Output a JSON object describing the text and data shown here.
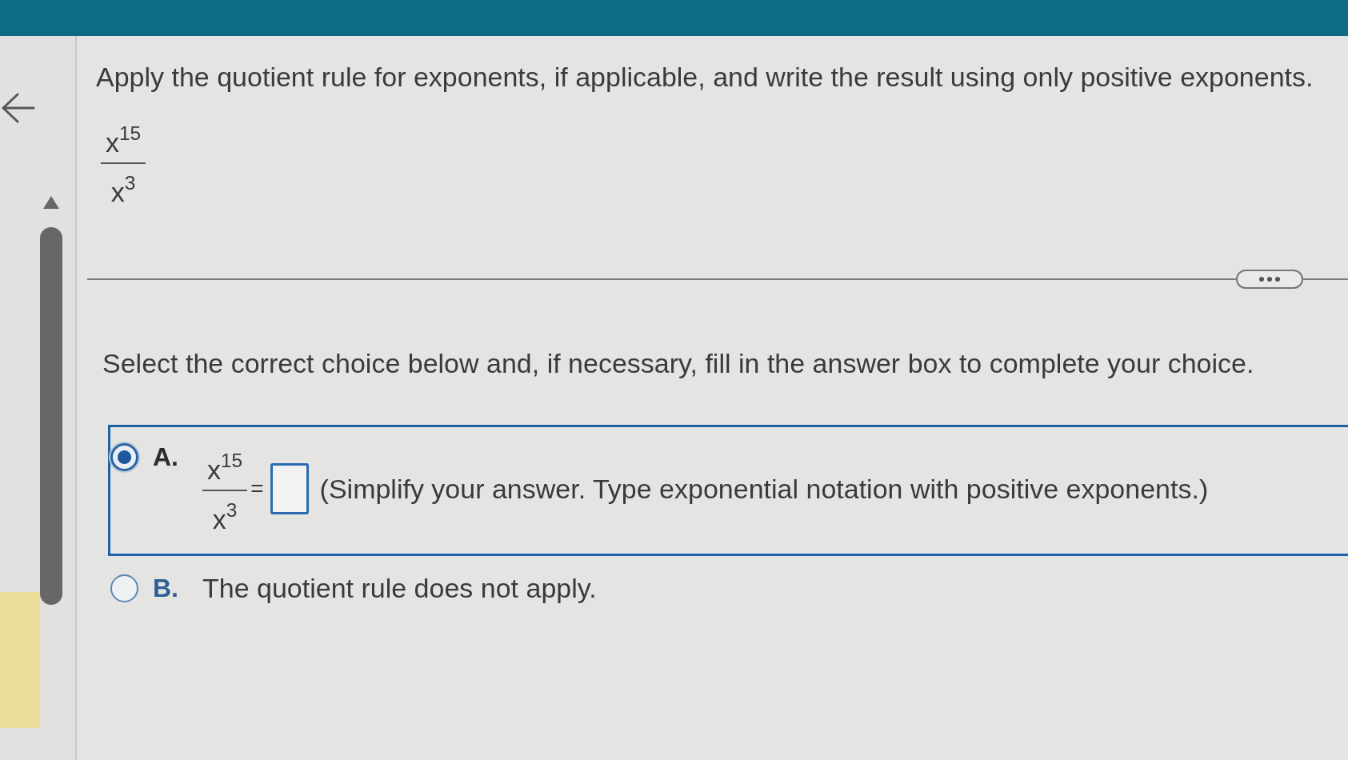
{
  "question": {
    "instruction": "Apply the quotient rule for exponents, if applicable, and write the result using only positive exponents.",
    "expression": {
      "numerator": "x$^{15}$",
      "denominator": "x$^{3}$"
    }
  },
  "prompt": "Select the correct choice below and, if necessary, fill in the answer box to complete your choice.",
  "choices": [
    {
      "letter": "A.",
      "selected": true,
      "kind": "equation",
      "expression": {
        "numerator": "x$^{15}$",
        "denominator": "x$^{3}$"
      },
      "equals": "=",
      "note": "(Simplify your answer. Type exponential notation with positive exponents.)"
    },
    {
      "letter": "B.",
      "selected": false,
      "kind": "statement",
      "text": "The quotient rule does not apply."
    }
  ]
}
